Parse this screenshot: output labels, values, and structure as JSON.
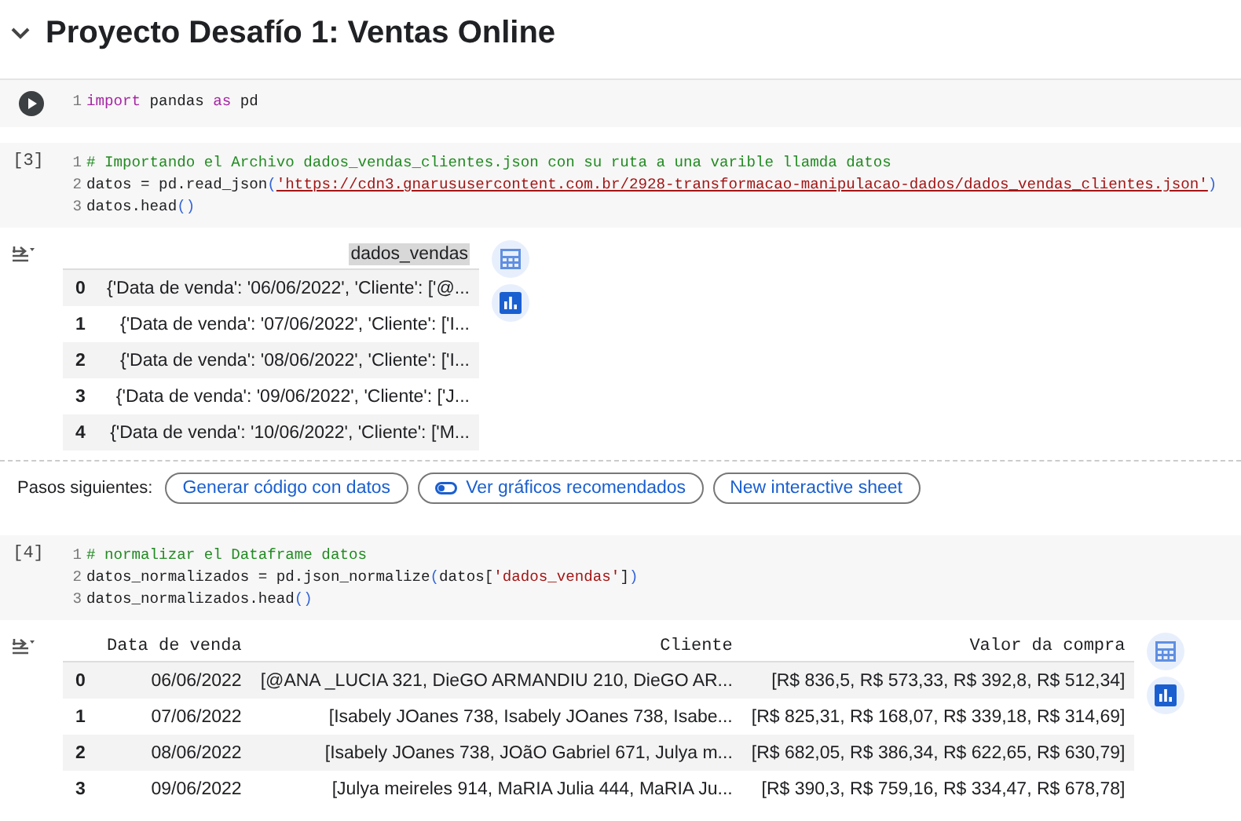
{
  "section": {
    "title": "Proyecto Desafío 1: Ventas Online",
    "expanded": true
  },
  "cells": [
    {
      "lines": [
        {
          "number": "1",
          "tokens": [
            {
              "kind": "kw",
              "text": "import"
            },
            {
              "kind": "plain",
              "text": " pandas "
            },
            {
              "kind": "kw",
              "text": "as"
            },
            {
              "kind": "plain",
              "text": " pd"
            }
          ]
        }
      ]
    },
    {
      "execution_count": "[3]",
      "lines": [
        {
          "number": "1",
          "tokens": [
            {
              "kind": "comment",
              "text": "# Importando el Archivo dados_vendas_clientes.json con su ruta a una varible llamda datos"
            }
          ]
        },
        {
          "number": "2",
          "tokens": [
            {
              "kind": "plain",
              "text": "datos = pd.read_json"
            },
            {
              "kind": "paren",
              "text": "("
            },
            {
              "kind": "url",
              "text": "'https://cdn3.gnarususercontent.com.br/2928-transformacao-manipulacao-dados/dados_vendas_clientes.json'"
            },
            {
              "kind": "paren",
              "text": ")"
            }
          ]
        },
        {
          "number": "3",
          "tokens": [
            {
              "kind": "plain",
              "text": "datos.head"
            },
            {
              "kind": "paren",
              "text": "()"
            }
          ]
        }
      ],
      "output": {
        "columns": [
          {
            "label": "dados_vendas",
            "highlighted": true
          }
        ],
        "rows": [
          {
            "index": "0",
            "cells": [
              "{'Data de venda': '06/06/2022', 'Cliente': ['@..."
            ]
          },
          {
            "index": "1",
            "cells": [
              "{'Data de venda': '07/06/2022', 'Cliente': ['I..."
            ]
          },
          {
            "index": "2",
            "cells": [
              "{'Data de venda': '08/06/2022', 'Cliente': ['I..."
            ]
          },
          {
            "index": "3",
            "cells": [
              "{'Data de venda': '09/06/2022', 'Cliente': ['J..."
            ]
          },
          {
            "index": "4",
            "cells": [
              "{'Data de venda': '10/06/2022', 'Cliente': ['M..."
            ]
          }
        ]
      },
      "next_steps": {
        "label": "Pasos siguientes:",
        "buttons": [
          {
            "label": "Generar código con datos",
            "icon": false
          },
          {
            "label": "Ver gráficos recomendados",
            "icon": true
          },
          {
            "label": "New interactive sheet",
            "icon": false
          }
        ]
      }
    },
    {
      "execution_count": "[4]",
      "lines": [
        {
          "number": "1",
          "tokens": [
            {
              "kind": "comment",
              "text": "# normalizar el Dataframe datos"
            }
          ]
        },
        {
          "number": "2",
          "tokens": [
            {
              "kind": "plain",
              "text": "datos_normalizados = pd.json_normalize"
            },
            {
              "kind": "paren",
              "text": "("
            },
            {
              "kind": "plain",
              "text": "datos["
            },
            {
              "kind": "str",
              "text": "'dados_vendas'"
            },
            {
              "kind": "plain",
              "text": "]"
            },
            {
              "kind": "paren",
              "text": ")"
            }
          ]
        },
        {
          "number": "3",
          "tokens": [
            {
              "kind": "plain",
              "text": "datos_normalizados.head"
            },
            {
              "kind": "paren",
              "text": "()"
            }
          ]
        }
      ],
      "output": {
        "columns": [
          {
            "label": "Data de venda",
            "highlighted": false
          },
          {
            "label": "Cliente",
            "highlighted": false
          },
          {
            "label": "Valor da compra",
            "highlighted": false
          }
        ],
        "rows": [
          {
            "index": "0",
            "cells": [
              "06/06/2022",
              "[@ANA _LUCIA 321, DieGO ARMANDIU 210, DieGO AR...",
              "[R$ 836,5, R$ 573,33, R$ 392,8, R$ 512,34]"
            ]
          },
          {
            "index": "1",
            "cells": [
              "07/06/2022",
              "[Isabely JOanes 738, Isabely JOanes 738, Isabe...",
              "[R$ 825,31, R$ 168,07, R$ 339,18, R$ 314,69]"
            ]
          },
          {
            "index": "2",
            "cells": [
              "08/06/2022",
              "[Isabely JOanes 738, JOãO Gabriel 671, Julya m...",
              "[R$ 682,05, R$ 386,34, R$ 622,65, R$ 630,79]"
            ]
          },
          {
            "index": "3",
            "cells": [
              "09/06/2022",
              "[Julya meireles 914, MaRIA Julia 444, MaRIA Ju...",
              "[R$ 390,3, R$ 759,16, R$ 334,47, R$ 678,78]"
            ]
          }
        ]
      }
    }
  ]
}
